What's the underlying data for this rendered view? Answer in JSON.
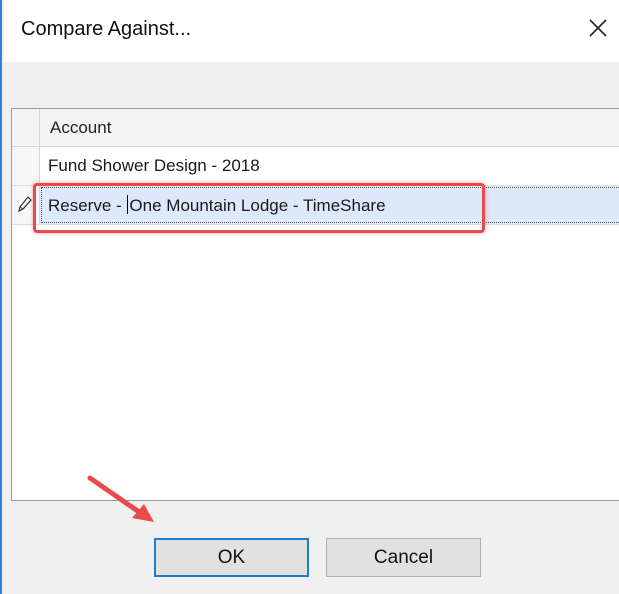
{
  "window": {
    "title": "Compare Against...",
    "close_icon": "close-icon"
  },
  "grid": {
    "columns": [
      "Account"
    ],
    "rows": [
      {
        "account": "Fund Shower Design - 2018",
        "editing": false
      },
      {
        "account_before_caret": "Reserve - ",
        "account_after_caret": "One Mountain Lodge - TimeShare",
        "editing": true
      }
    ],
    "edit_icon": "pencil-icon"
  },
  "buttons": {
    "ok_label": "OK",
    "cancel_label": "Cancel"
  },
  "annotations": {
    "highlight_color": "#e84b4b",
    "arrow_color": "#e84b4b"
  },
  "colors": {
    "window_border": "#3a7bd5",
    "selected_row": "#dde8fb",
    "ok_border": "#1f7ad1"
  }
}
